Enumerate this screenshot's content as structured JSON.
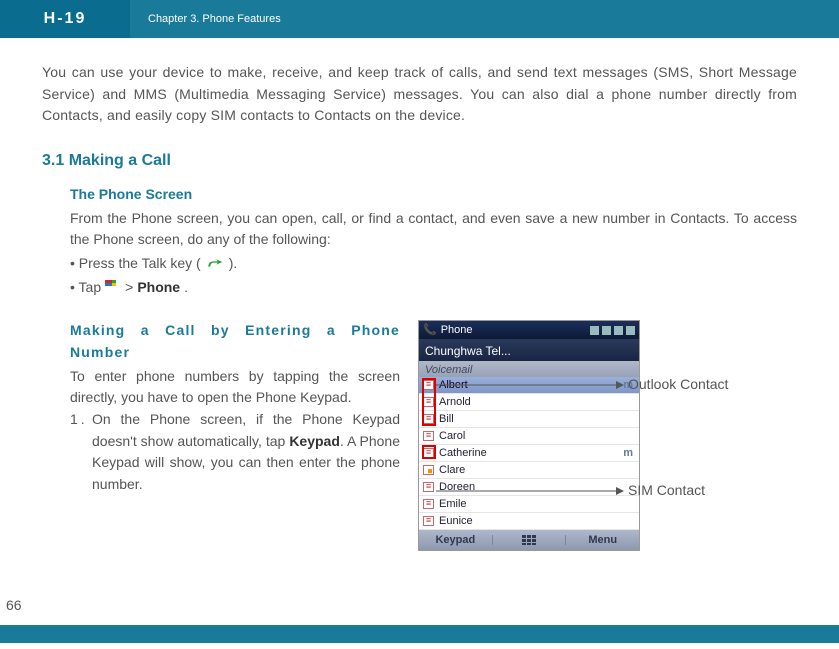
{
  "header": {
    "logo": "H-19",
    "chapter": "Chapter 3. Phone Features"
  },
  "intro": "You can use your device to make, receive, and keep track of calls, and send text messages (SMS, Short Message Service) and MMS (Multimedia Messaging Service) messages. You can also dial a phone number directly from Contacts, and easily copy SIM contacts to Contacts on the device.",
  "section": {
    "number_title": "3.1 Making a Call",
    "sub1": {
      "title": "The Phone Screen",
      "body": "From the Phone screen, you can open, call, or find a contact, and even save a new number in Contacts. To access the Phone screen, do any of the following:",
      "bullet1_a": "• Press the Talk key (",
      "bullet1_b": ").",
      "bullet2_a": "• Tap",
      "bullet2_b": ">",
      "bullet2_c": "Phone",
      "bullet2_d": "."
    },
    "sub2": {
      "title": "Making a Call by Entering a Phone Number",
      "body": "To enter phone numbers by tapping the screen directly, you have to open the Phone Keypad.",
      "step_num": "1.",
      "step_a": "On the Phone screen, if the Phone Keypad doesn't show automatically, tap ",
      "step_bold": "Keypad",
      "step_b": ". A Phone Keypad will show, you can then enter the phone number."
    }
  },
  "phone": {
    "title": "Phone",
    "carrier": "Chunghwa Tel...",
    "voicemail": "Voicemail",
    "rows": [
      "Albert",
      "Arnold",
      "Bill",
      "Carol",
      "Catherine",
      "Clare",
      "Doreen",
      "Emile",
      "Eunice"
    ],
    "bottom_left": "Keypad",
    "bottom_right": "Menu"
  },
  "callouts": {
    "outlook": "Outlook Contact",
    "sim": "SIM Contact"
  },
  "page": "66"
}
